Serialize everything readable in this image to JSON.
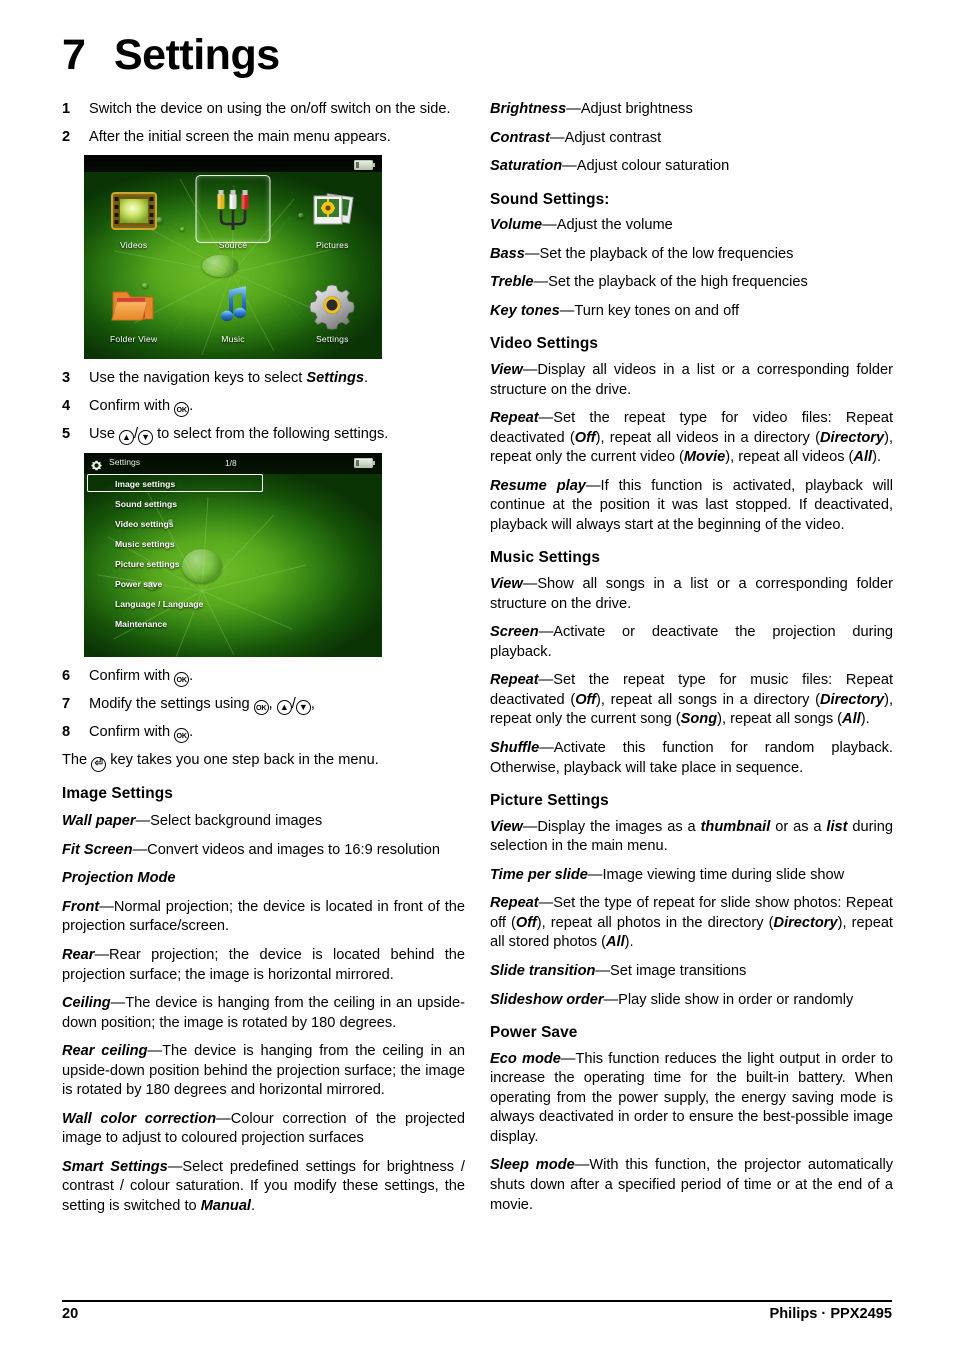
{
  "chapter": {
    "number": "7",
    "title": "Settings"
  },
  "footer": {
    "page_number": "20",
    "brand": "Philips · PPX2495"
  },
  "steps": {
    "s1_num": "1",
    "s1_text": "Switch the device on using the on/off switch on the side.",
    "s2_num": "2",
    "s2_text": "After the initial screen the main menu appears.",
    "s3_num": "3",
    "s3_pre": "Use the navigation keys to select ",
    "s3_bold": "Settings",
    "s3_post": ".",
    "s4_num": "4",
    "s4_pre": "Confirm with ",
    "s4_post": ".",
    "s5_num": "5",
    "s5_pre": "Use ",
    "s5_mid": "/",
    "s5_post": " to select from the following settings.",
    "s6_num": "6",
    "s6_pre": "Confirm with ",
    "s6_post": ".",
    "s7_num": "7",
    "s7_pre": "Modify the settings using ",
    "s7_mid1": ", ",
    "s7_mid2": "/",
    "s7_post": ",",
    "s8_num": "8",
    "s8_pre": "Confirm with ",
    "s8_post": ".",
    "back_pre": "The ",
    "back_post": " key takes you one step back in the menu.",
    "key_ok": "OK",
    "key_up": "▲",
    "key_down": "▼",
    "key_back": "⏎"
  },
  "main_menu_screen": {
    "battery_icon": "battery-icon",
    "items": [
      {
        "label": "Videos",
        "icon": "videos-icon",
        "selected": false
      },
      {
        "label": "Source",
        "icon": "source-icon",
        "selected": true
      },
      {
        "label": "Pictures",
        "icon": "pictures-icon",
        "selected": false
      },
      {
        "label": "Folder View",
        "icon": "folder-view-icon",
        "selected": false
      },
      {
        "label": "Music",
        "icon": "music-icon",
        "selected": false
      },
      {
        "label": "Settings",
        "icon": "settings-gear-icon",
        "selected": false
      }
    ]
  },
  "settings_screen": {
    "title": "Settings",
    "page_indicator": "1/8",
    "battery_icon": "battery-icon",
    "gear_icon": "gear-icon",
    "items": [
      {
        "label": "Image settings",
        "selected": true
      },
      {
        "label": "Sound settings",
        "selected": false
      },
      {
        "label": "Video settings",
        "selected": false
      },
      {
        "label": "Music settings",
        "selected": false
      },
      {
        "label": "Picture settings",
        "selected": false
      },
      {
        "label": "Power save",
        "selected": false
      },
      {
        "label": "Language / Language",
        "selected": false
      },
      {
        "label": "Maintenance",
        "selected": false
      }
    ]
  },
  "image_settings": {
    "heading": "Image Settings",
    "wall_paper_term": "Wall paper",
    "wall_paper_desc": "—Select background images",
    "fit_screen_term": "Fit Screen",
    "fit_screen_desc": "—Convert videos and images to 16:9 resolution",
    "projection_mode_term": "Projection Mode",
    "front_term": "Front",
    "front_desc": "—Normal projection; the device is located in front of the projection surface/screen.",
    "rear_term": "Rear",
    "rear_desc": "—Rear projection; the device is located behind the projection surface; the image is horizontal mirrored.",
    "ceiling_term": "Ceiling",
    "ceiling_desc": "—The device is hanging from the ceiling in an upside-down position; the image is rotated by 180 degrees.",
    "rear_ceiling_term": "Rear ceiling",
    "rear_ceiling_desc": "—The device is hanging from the ceiling in an upside-down position behind the projection surface; the image is rotated by 180 degrees and horizontal mirrored.",
    "wall_color_term": "Wall color correction",
    "wall_color_desc": "—Colour correction of the projected image to adjust to coloured projection surfaces",
    "smart_settings_term": "Smart Settings",
    "smart_settings_desc_a": "—Select predefined settings for brightness / contrast / colour saturation. If you modify these settings, the setting is switched to ",
    "smart_settings_bold": "Manual",
    "smart_settings_desc_b": ".",
    "brightness_term": "Brightness",
    "brightness_desc": "—Adjust brightness",
    "contrast_term": "Contrast",
    "contrast_desc": "—Adjust contrast",
    "saturation_term": "Saturation",
    "saturation_desc": "—Adjust colour saturation"
  },
  "sound_settings": {
    "heading": "Sound Settings:",
    "volume_term": "Volume",
    "volume_desc": "—Adjust the volume",
    "bass_term": "Bass",
    "bass_desc": "—Set the playback of the low frequencies",
    "treble_term": "Treble",
    "treble_desc": "—Set the playback of the high frequencies",
    "key_tones_term": "Key tones",
    "key_tones_desc": "—Turn key tones on and off"
  },
  "video_settings": {
    "heading": "Video Settings",
    "view_term": "View",
    "view_desc": "—Display all videos in a list or a corresponding folder structure on the drive.",
    "repeat_term": "Repeat",
    "repeat_a": "—Set the repeat type for video files: Repeat deactivated (",
    "repeat_off": "Off",
    "repeat_b": "), repeat all videos in a directory (",
    "repeat_directory": "Directory",
    "repeat_c": "), repeat only the current video (",
    "repeat_movie": "Movie",
    "repeat_d": "), repeat all videos (",
    "repeat_all": "All",
    "repeat_e": ").",
    "resume_term": "Resume play",
    "resume_desc": "—If this function is activated, playback will continue at the position it was last stopped. If deactivated, playback will always start at the beginning of the video."
  },
  "music_settings": {
    "heading": "Music Settings",
    "view_term": "View",
    "view_desc": "—Show all songs in a list or a corresponding folder structure on the drive.",
    "screen_term": "Screen",
    "screen_desc": "—Activate or deactivate the projection during playback.",
    "repeat_term": "Repeat",
    "repeat_a": "—Set the repeat type for music files: Repeat deactivated (",
    "repeat_off": "Off",
    "repeat_b": "), repeat all songs in a directory (",
    "repeat_directory": "Directory",
    "repeat_c": "), repeat only the current song (",
    "repeat_song": "Song",
    "repeat_d": "), repeat all songs (",
    "repeat_all": "All",
    "repeat_e": ").",
    "shuffle_term": "Shuffle",
    "shuffle_desc": "—Activate this function for random playback. Otherwise, playback will take place in sequence."
  },
  "picture_settings": {
    "heading": "Picture Settings",
    "view_term": "View",
    "view_a": "—Display the images as a ",
    "view_thumbnail": "thumbnail",
    "view_b": " or as a ",
    "view_list": "list",
    "view_c": " during selection in the main menu.",
    "time_per_slide_term": "Time per slide",
    "time_per_slide_desc": "—Image viewing time during slide show",
    "repeat_term": "Repeat",
    "repeat_a": "—Set the type of repeat for slide show photos: Repeat off (",
    "repeat_off": "Off",
    "repeat_b": "), repeat all photos in the directory (",
    "repeat_directory": "Directory",
    "repeat_c": "), repeat all stored photos (",
    "repeat_all": "All",
    "repeat_d": ").",
    "slide_transition_term": "Slide transition",
    "slide_transition_desc": "—Set image transitions",
    "slideshow_order_term": "Slideshow order",
    "slideshow_order_desc": "—Play slide show in order or randomly"
  },
  "power_save": {
    "heading": "Power Save",
    "eco_term": "Eco mode",
    "eco_desc": "—This function reduces the light output in order to increase the operating time for the built-in battery. When operating from the power supply, the energy saving mode is always deactivated in order to ensure the best-possible image display.",
    "sleep_term": "Sleep mode",
    "sleep_desc": "—With this function, the projector automatically shuts down after a specified period of time or at the end of a movie."
  }
}
